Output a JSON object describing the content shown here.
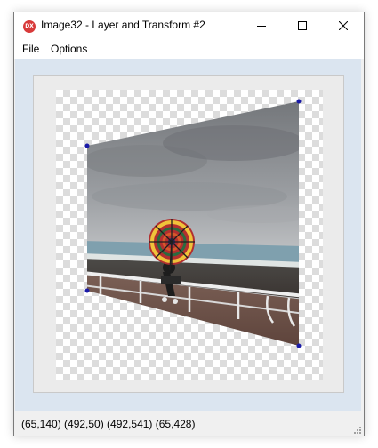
{
  "window": {
    "title": "Image32 - Layer and Transform #2",
    "icon": "dx-app-icon",
    "icon_text": "DX",
    "icon_color": "#d83a3a",
    "controls": [
      "minimize-icon",
      "maximize-icon",
      "close-icon"
    ]
  },
  "menu": {
    "items": [
      {
        "label": "File"
      },
      {
        "label": "Options"
      }
    ]
  },
  "canvas": {
    "content": "transformed-image",
    "handle_color": "#1a1aa8",
    "background": "transparency-checkerboard"
  },
  "status": {
    "text": "(65,140)  (492,50)  (492,541)  (65,428)"
  }
}
